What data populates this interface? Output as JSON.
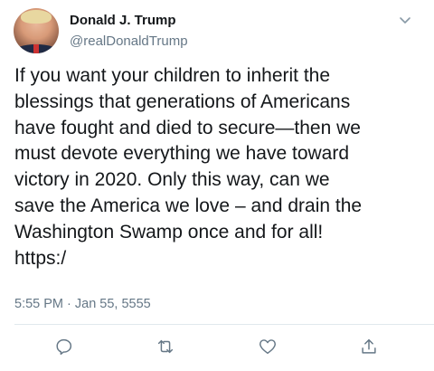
{
  "user": {
    "display_name": "Donald J. Trump",
    "handle": "@realDonaldTrump"
  },
  "tweet": {
    "lines": [
      "If you want your children to inherit the",
      "blessings that generations of Americans",
      "have fought and died to secure—then we",
      "must devote everything we have toward",
      "victory in 2020. Only this way, can we",
      "save the America we love – and drain the",
      "Washington Swamp once and for all!",
      "https:/"
    ],
    "timestamp": "5:55 PM · Jan 55, 5555"
  },
  "actions": [
    "reply-icon",
    "retweet-icon",
    "like-icon",
    "share-icon"
  ],
  "colors": {
    "text": "#14171a",
    "secondary": "#657786",
    "icon": "#657786",
    "divider": "#e1e8ed"
  }
}
